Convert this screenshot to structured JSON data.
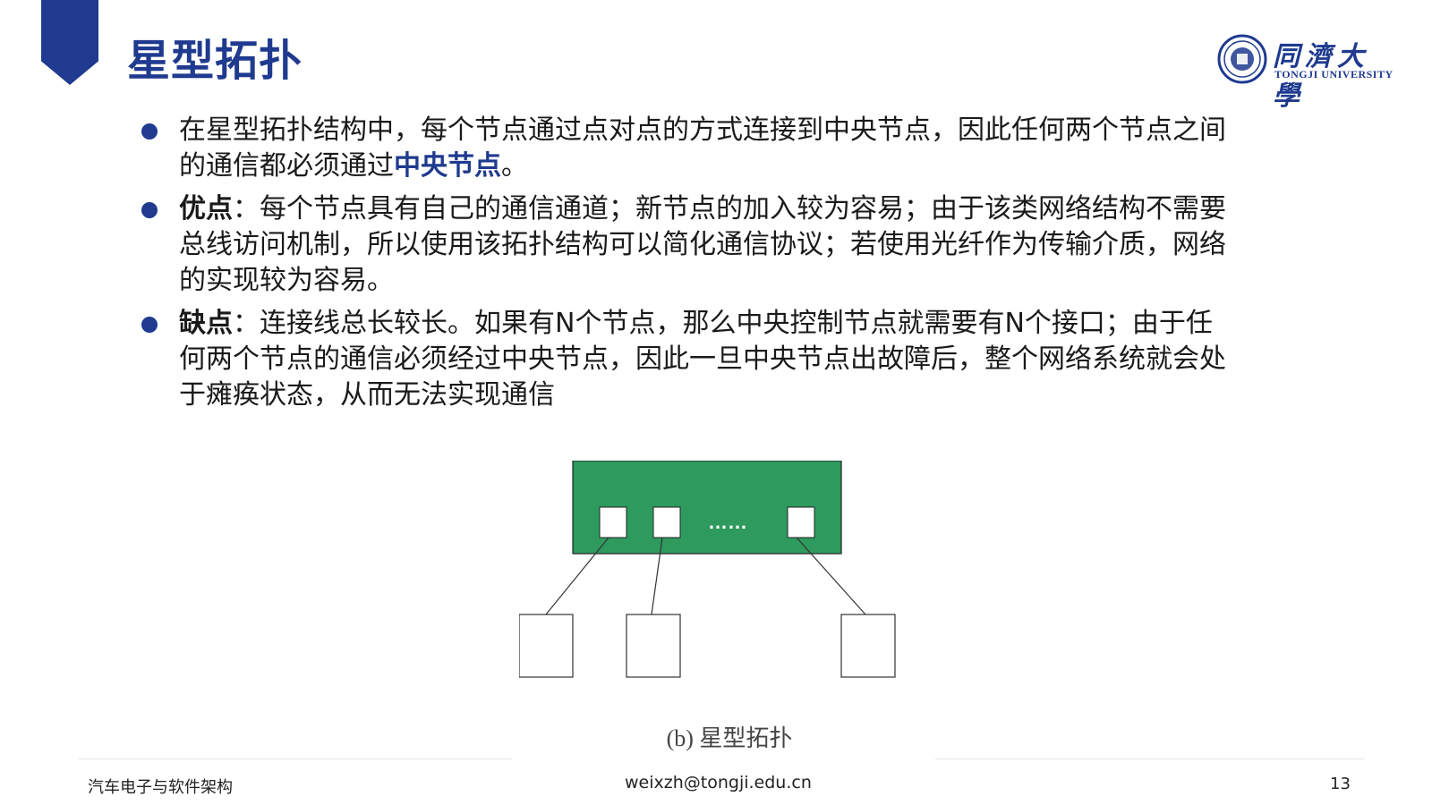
{
  "slide": {
    "title": "星型拓扑",
    "accent_color": "#1f3a8f",
    "logo": {
      "name_cn": "同濟大學",
      "name_en": "TONGJI UNIVERSITY",
      "seal_icon": "university-seal-icon"
    }
  },
  "bullets": [
    {
      "text_before": "在星型拓扑结构中，每个节点通过点对点的方式连接到中央节点，因此任何两个节点之间的通信都必须通过",
      "highlight": "中央节点",
      "text_after": "。"
    },
    {
      "label": "优点",
      "text": "：每个节点具有自己的通信通道；新节点的加入较为容易；由于该类网络结构不需要总线访问机制，所以使用该拓扑结构可以简化通信协议；若使用光纤作为传输介质，网络的实现较为容易。"
    },
    {
      "label": "缺点",
      "text": "：连接线总长较长。如果有N个节点，那么中央控制节点就需要有N个接口；由于任何两个节点的通信必须经过中央节点，因此一旦中央节点出故障后，整个网络系统就会处于瘫痪状态，从而无法实现通信"
    }
  ],
  "diagram": {
    "hub_color": "#2e9a5e",
    "ellipsis": "……",
    "caption": "(b) 星型拓扑"
  },
  "footer": {
    "course": "汽车电子与软件架构",
    "email": "weixzh@tongji.edu.cn",
    "page_number": "13"
  }
}
